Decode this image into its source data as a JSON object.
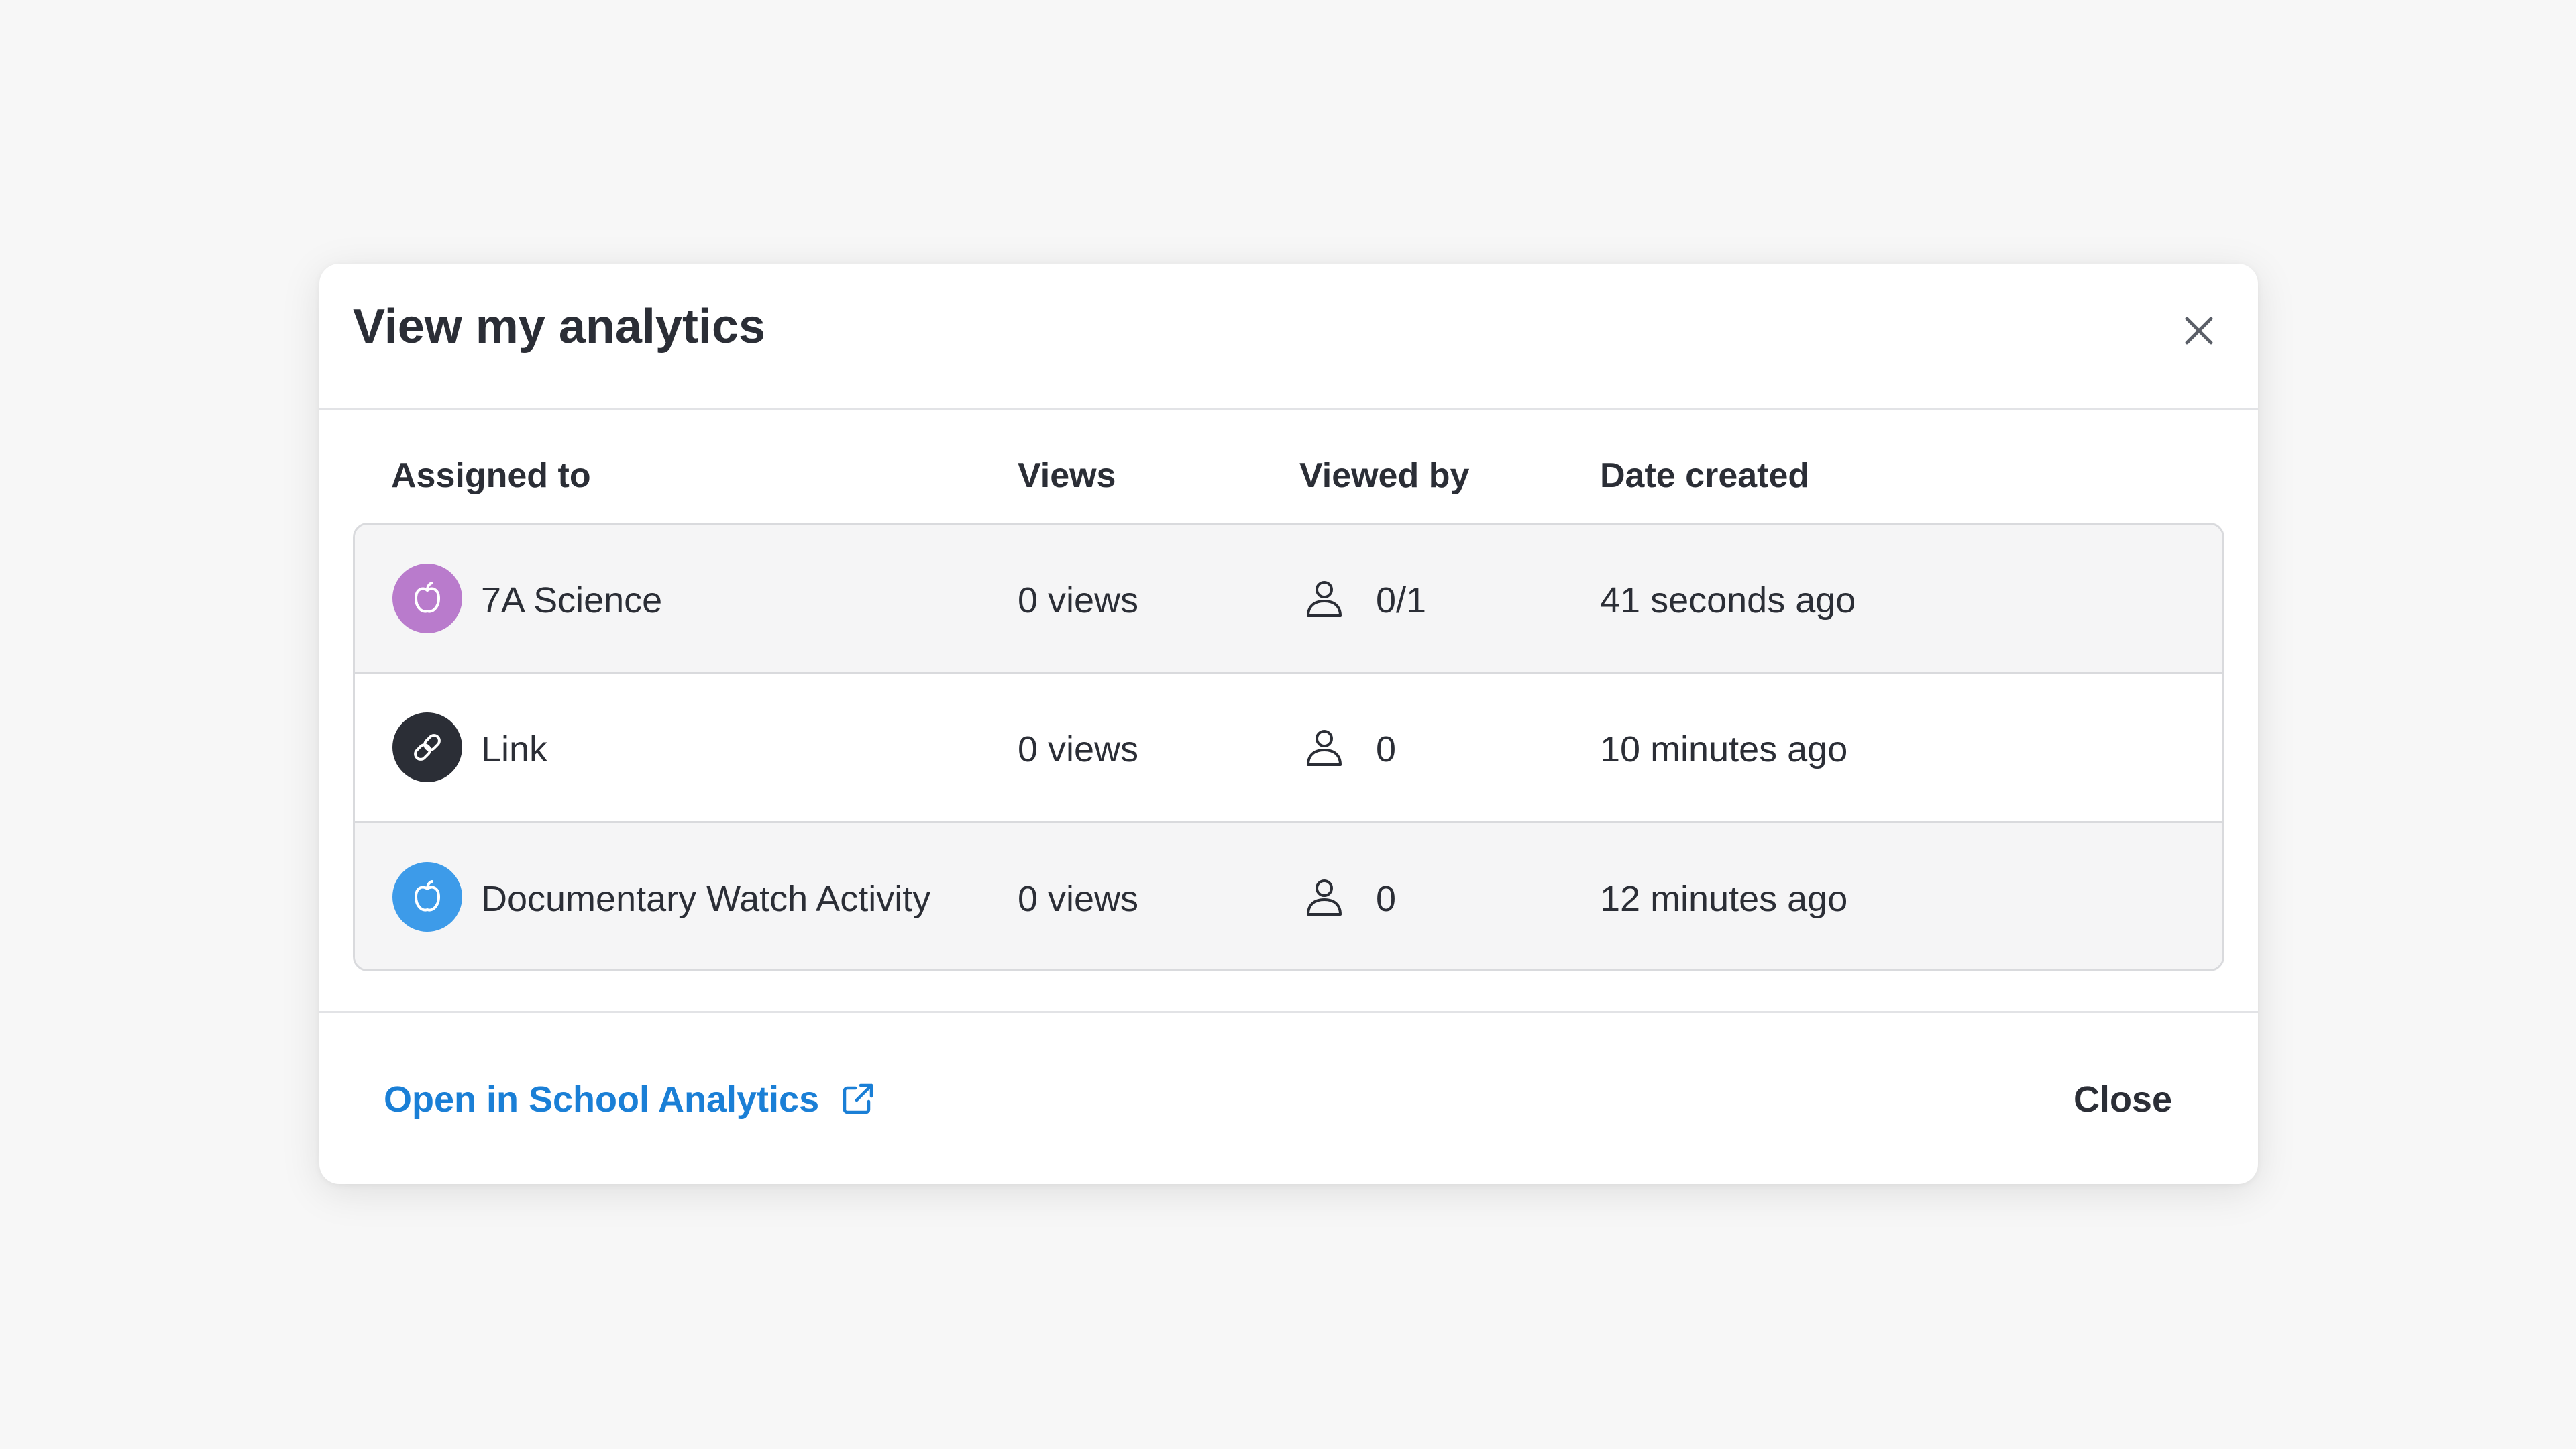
{
  "modal": {
    "title": "View my analytics"
  },
  "table": {
    "columns": [
      "Assigned to",
      "Views",
      "Viewed by",
      "Date created"
    ],
    "rows": [
      {
        "icon": "apple-icon",
        "icon_color": "#b97bcc",
        "assigned_to": "7A Science",
        "views": "0 views",
        "viewed_by": "0/1",
        "date_created": "41 seconds ago"
      },
      {
        "icon": "link-icon",
        "icon_color": "#2b2e36",
        "assigned_to": "Link",
        "views": "0 views",
        "viewed_by": "0",
        "date_created": "10 minutes ago"
      },
      {
        "icon": "apple-icon",
        "icon_color": "#3d9be9",
        "assigned_to": "Documentary Watch Activity",
        "views": "0 views",
        "viewed_by": "0",
        "date_created": "12 minutes ago"
      }
    ]
  },
  "footer": {
    "open_link_label": "Open in School Analytics",
    "close_label": "Close"
  },
  "colors": {
    "link": "#1a7fd6",
    "text": "#2b2e36",
    "background": "#f7f7f7"
  }
}
